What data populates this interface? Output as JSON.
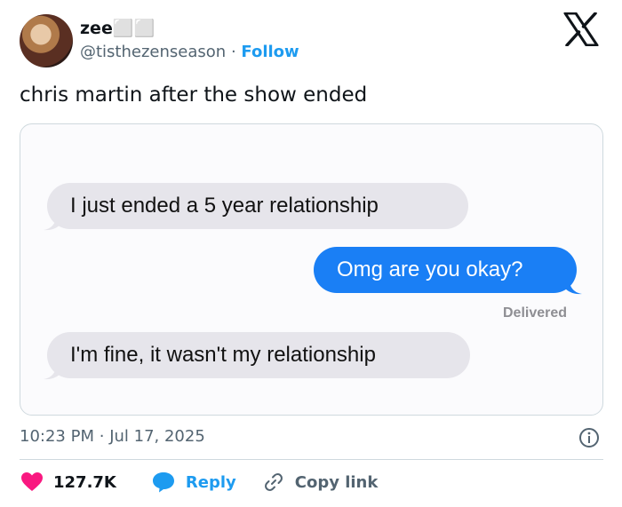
{
  "author": {
    "name": "zee⬜⬜",
    "handle": "@tisthezenseason",
    "separator": "·",
    "follow_label": "Follow"
  },
  "tweet": {
    "text": "chris martin after the show ended"
  },
  "media": {
    "messages": [
      {
        "side": "received",
        "text": "I just ended a 5 year relationship"
      },
      {
        "side": "sent",
        "text": "Omg are you okay?"
      },
      {
        "side": "received",
        "text": "I'm fine, it wasn't my relationship"
      }
    ],
    "status": "Delivered",
    "colors": {
      "sent_bubble": "#1a7ff5",
      "received_bubble": "#e6e5eb"
    }
  },
  "meta": {
    "time": "10:23 PM",
    "separator": "·",
    "date": "Jul 17, 2025"
  },
  "actions": {
    "likes": "127.7K",
    "reply_label": "Reply",
    "copy_link_label": "Copy link"
  },
  "icons": [
    "x-logo-icon",
    "info-icon",
    "heart-icon",
    "reply-bubble-icon",
    "link-icon"
  ],
  "colors": {
    "accent": "#1d9bf0",
    "heart": "#f91880",
    "muted": "#536471"
  }
}
